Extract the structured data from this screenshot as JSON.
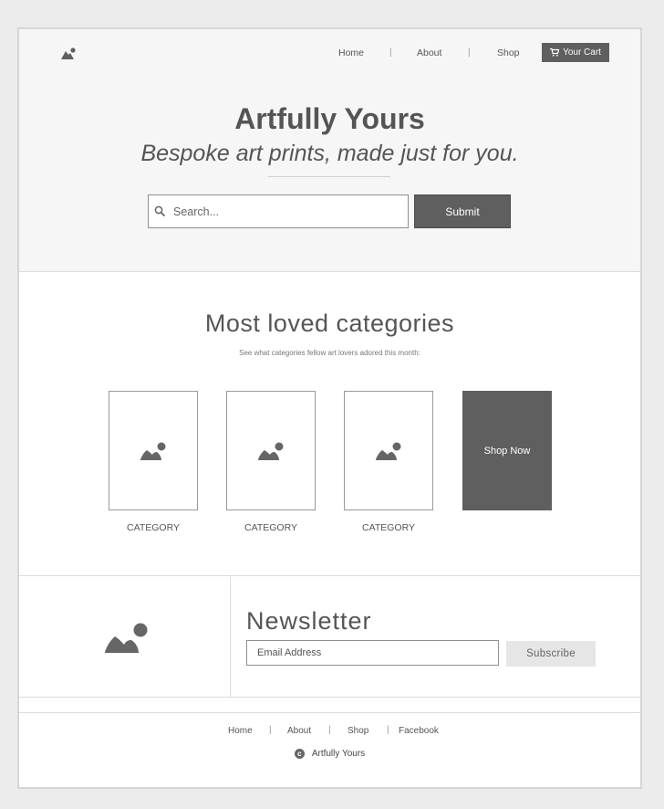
{
  "header": {
    "nav": [
      {
        "label": "Home"
      },
      {
        "label": "About"
      },
      {
        "label": "Shop"
      }
    ],
    "separator": "|",
    "cart_label": "Your Cart"
  },
  "hero": {
    "title": "Artfully Yours",
    "subtitle": "Bespoke art prints, made just for you.",
    "search_placeholder": "Search...",
    "submit_label": "Submit"
  },
  "categories": {
    "title": "Most loved categories",
    "subtitle": "See what categories fellow art lovers adored this month:",
    "items": [
      {
        "label": "CATEGORY"
      },
      {
        "label": "CATEGORY"
      },
      {
        "label": "CATEGORY"
      }
    ],
    "cta_label": "Shop Now"
  },
  "newsletter": {
    "title": "Newsletter",
    "email_placeholder": "Email Address",
    "subscribe_label": "Subscribe"
  },
  "footer": {
    "nav": [
      {
        "label": "Home"
      },
      {
        "label": "About"
      },
      {
        "label": "Shop"
      },
      {
        "label": "Facebook"
      }
    ],
    "copyright_symbol": "c",
    "copyright_text": "Artfully Yours"
  },
  "colors": {
    "page_bg": "#ececec",
    "hero_bg": "#f6f6f6",
    "dark_button": "#5f5f5f",
    "light_button": "#e6e6e6",
    "text": "#555555"
  },
  "icons": [
    "logo-icon",
    "cart-icon",
    "search-icon",
    "image-placeholder-icon",
    "copyright-icon"
  ]
}
